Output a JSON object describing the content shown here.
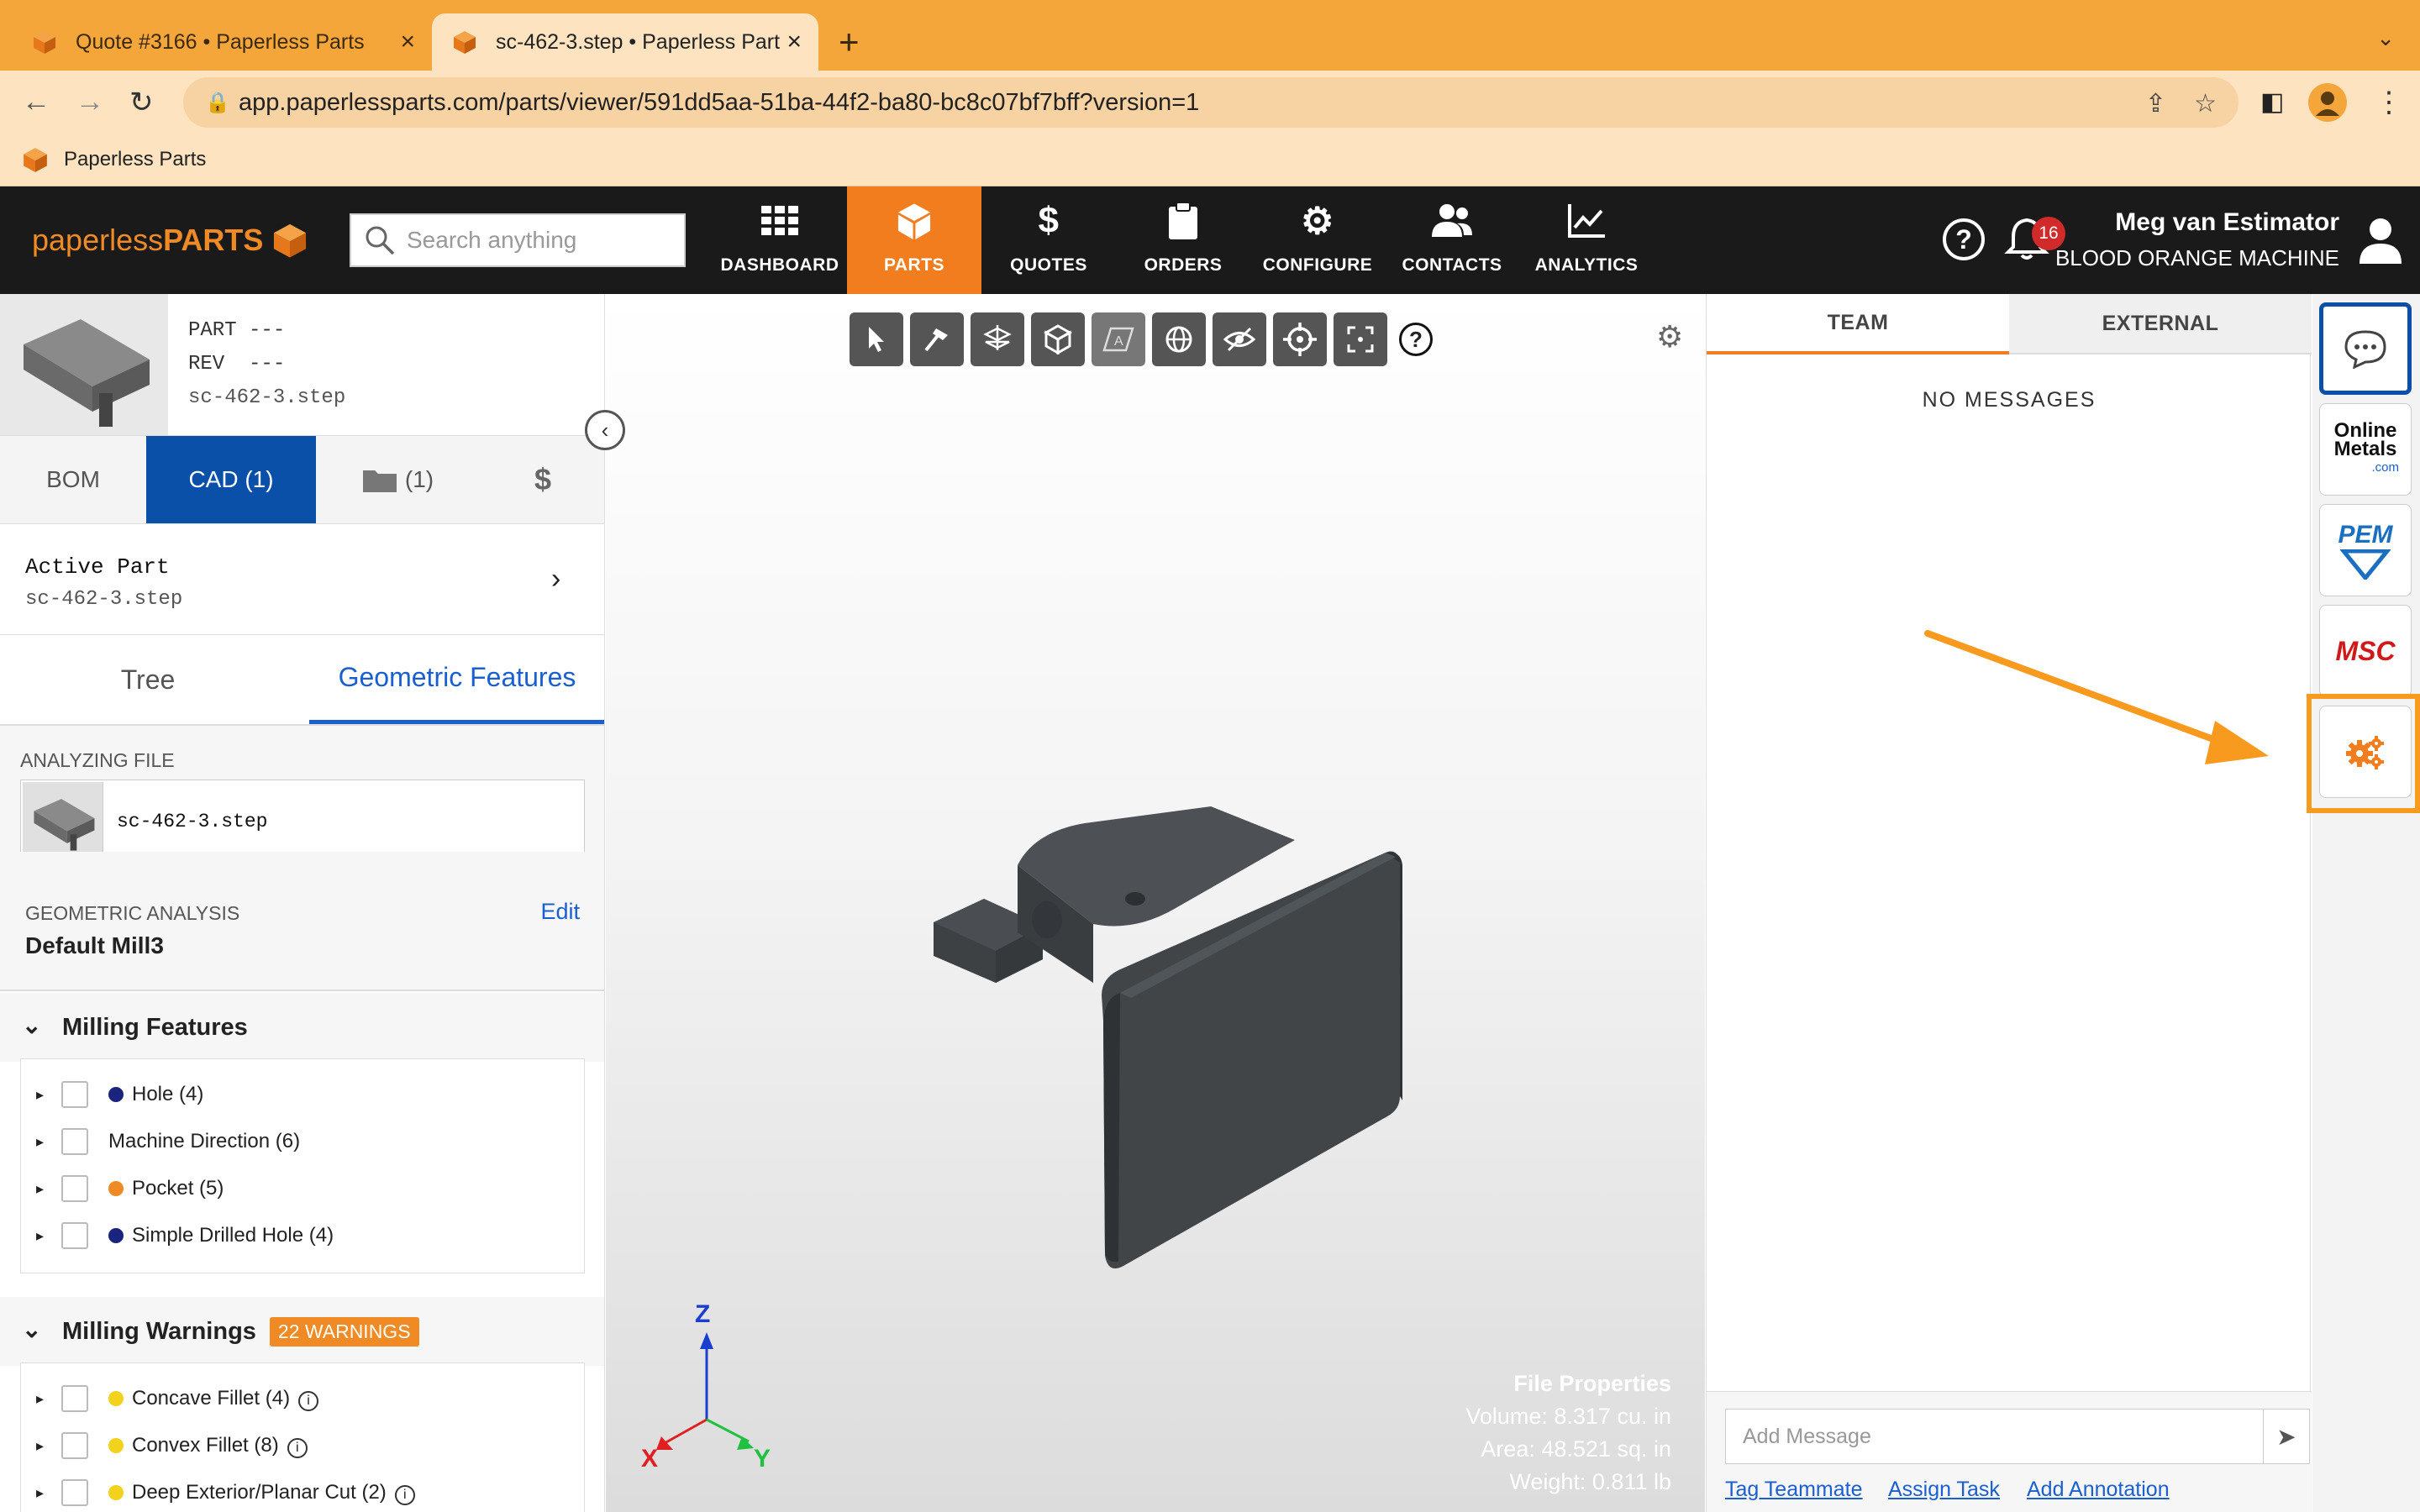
{
  "browser": {
    "tabs": [
      {
        "title": "Quote #3166 • Paperless Parts",
        "active": false
      },
      {
        "title": "sc-462-3.step • Paperless Part",
        "active": true
      }
    ],
    "url": "app.paperlessparts.com/parts/viewer/591dd5aa-51ba-44f2-ba80-bc8c07bf7bff?version=1",
    "bookmark": "Paperless Parts"
  },
  "header": {
    "logo_prefix": "paperless",
    "logo_bold": "PARTS",
    "search_placeholder": "Search anything",
    "nav": [
      {
        "label": "DASHBOARD",
        "icon": "grid-icon",
        "active": false
      },
      {
        "label": "PARTS",
        "icon": "cube-icon",
        "active": true
      },
      {
        "label": "QUOTES",
        "icon": "dollar-icon",
        "active": false
      },
      {
        "label": "ORDERS",
        "icon": "clipboard-icon",
        "active": false
      },
      {
        "label": "CONFIGURE",
        "icon": "gears-icon",
        "active": false
      },
      {
        "label": "CONTACTS",
        "icon": "people-icon",
        "active": false
      },
      {
        "label": "ANALYTICS",
        "icon": "chart-icon",
        "active": false
      }
    ],
    "notification_count": "16",
    "user_name": "Meg van Estimator",
    "company": "BLOOD ORANGE MACHINE"
  },
  "part": {
    "part_label": "PART",
    "part_value": "---",
    "rev_label": "REV",
    "rev_value": "---",
    "filename": "sc-462-3.step"
  },
  "panel_tabs": {
    "bom": "BOM",
    "cad": "CAD (1)",
    "files": "(1)",
    "pricing": "$"
  },
  "active_part": {
    "label": "Active Part",
    "file": "sc-462-3.step"
  },
  "subtabs": {
    "tree": "Tree",
    "geometric": "Geometric Features"
  },
  "analyzing": {
    "label": "ANALYZING FILE",
    "file": "sc-462-3.step"
  },
  "geometric_analysis": {
    "label": "GEOMETRIC ANALYSIS",
    "value": "Default Mill3",
    "edit": "Edit"
  },
  "milling_features": {
    "title": "Milling Features",
    "items": [
      {
        "label": "Hole (4)",
        "dot": "#1a237e"
      },
      {
        "label": "Machine Direction (6)",
        "dot": ""
      },
      {
        "label": "Pocket (5)",
        "dot": "#f08a24"
      },
      {
        "label": "Simple Drilled Hole (4)",
        "dot": "#1a237e"
      }
    ]
  },
  "milling_warnings": {
    "title": "Milling Warnings",
    "badge": "22 WARNINGS",
    "items": [
      {
        "label": "Concave Fillet (4)",
        "dot": "#f2d21b"
      },
      {
        "label": "Convex Fillet (8)",
        "dot": "#f2d21b"
      },
      {
        "label": "Deep Exterior/Planar Cut (2)",
        "dot": "#f2d21b"
      }
    ]
  },
  "viewer": {
    "axes": {
      "x": "X",
      "y": "Y",
      "z": "Z"
    },
    "file_properties": {
      "title": "File Properties",
      "volume": "Volume: 8.317 cu. in",
      "area": "Area: 48.521 sq. in",
      "weight": "Weight: 0.811 lb"
    }
  },
  "chat": {
    "tab_team": "TEAM",
    "tab_external": "EXTERNAL",
    "empty": "NO MESSAGES",
    "placeholder": "Add Message",
    "links": [
      "Tag Teammate",
      "Assign Task",
      "Add Annotation"
    ]
  },
  "integrations": {
    "online_metals_line1": "Online",
    "online_metals_line2": "Metals",
    "online_metals_line3": ".com",
    "pem": "PEM",
    "msc": "MSC"
  },
  "colors": {
    "brand_orange": "#f27d1e",
    "active_blue": "#0a4fa8",
    "link_blue": "#1a5fd0",
    "annotation_orange": "#f79a1e"
  }
}
